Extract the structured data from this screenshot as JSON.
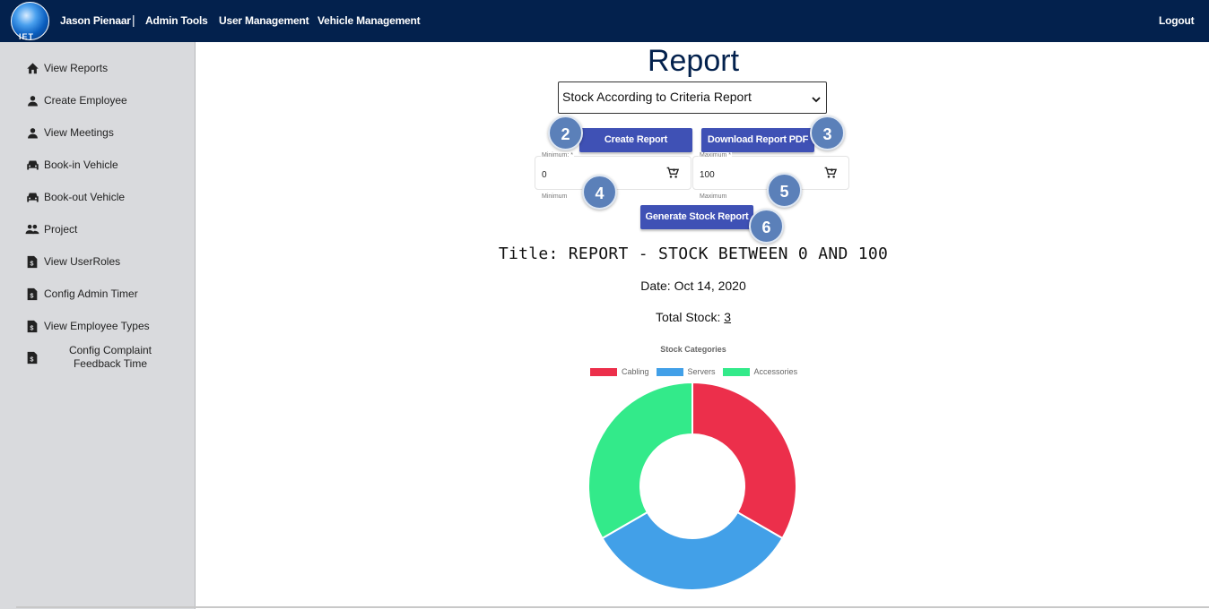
{
  "topbar": {
    "logo_text": "IET",
    "user_name": "Jason Pienaar",
    "separator": "|",
    "nav": [
      "Admin Tools",
      "User Management",
      "Vehicle Management"
    ],
    "logout": "Logout"
  },
  "sidebar": {
    "items": [
      {
        "label": "View Reports",
        "icon": "home-icon"
      },
      {
        "label": "Create Employee",
        "icon": "person-icon"
      },
      {
        "label": "View Meetings",
        "icon": "person-icon"
      },
      {
        "label": "Book-in Vehicle",
        "icon": "car-icon"
      },
      {
        "label": "Book-out Vehicle",
        "icon": "car-icon"
      },
      {
        "label": "Project",
        "icon": "people-icon"
      },
      {
        "label": "View UserRoles",
        "icon": "document-dollar-icon"
      },
      {
        "label": "Config Admin Timer",
        "icon": "document-dollar-icon"
      },
      {
        "label": "View Employee Types",
        "icon": "document-dollar-icon"
      },
      {
        "label": "Config Complaint Feedback Time",
        "icon": "document-dollar-icon"
      }
    ]
  },
  "main": {
    "title": "Report",
    "report_select": "Stock According to Criteria Report",
    "create_button": "Create Report",
    "download_button": "Download Report PDF",
    "minimum": {
      "label": "Minimum: *",
      "value": "0",
      "hint": "Minimum"
    },
    "maximum": {
      "label": "Maximum *",
      "value": "100",
      "hint": "Maximum"
    },
    "generate_button": "Generate Stock Report",
    "badges": [
      "2",
      "3",
      "4",
      "5",
      "6"
    ],
    "report_title": "Title: REPORT - STOCK BETWEEN 0 AND 100",
    "report_date": "Date: Oct 14, 2020",
    "total_label": "Total Stock: ",
    "total_value": "3"
  },
  "colors": {
    "navbar": "#03214d",
    "sidebar": "#d9dadd",
    "button": "#3f51b5",
    "badge": "#5b80b9"
  },
  "chart_data": {
    "type": "doughnut",
    "title": "Stock Categories",
    "categories": [
      "Cabling",
      "Servers",
      "Accessories"
    ],
    "values": [
      1,
      1,
      1
    ],
    "colors": [
      "#ec2f4b",
      "#42a0e8",
      "#33ea8a"
    ],
    "legend_position": "top"
  }
}
